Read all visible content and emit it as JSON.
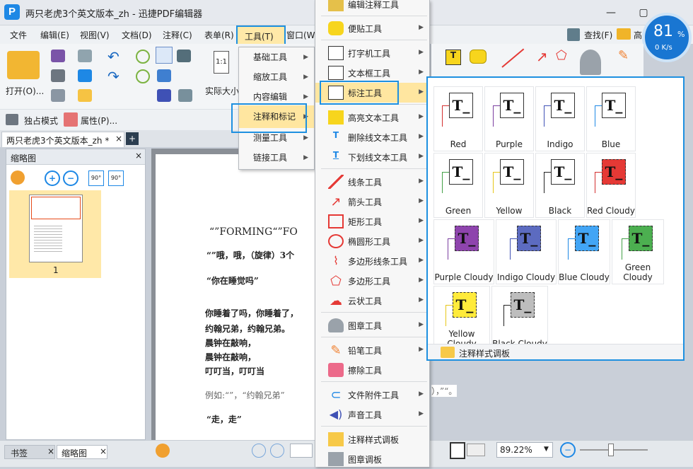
{
  "window": {
    "title": "两只老虎3个英文版本_zh - 迅捷PDF编辑器",
    "logo": "P"
  },
  "menubar": [
    "文件",
    "编辑(E)",
    "视图(V)",
    "文档(D)",
    "注释(C)",
    "表单(R)",
    "工具(T)",
    "窗口(W",
    "查找(F)",
    "高"
  ],
  "ribbon": {
    "open": "打开(O)...",
    "actual_size": "实际大小",
    "single_mode": "独占模式",
    "properties": "属性(P)..."
  },
  "doc_tab": "两只老虎3个英文版本_zh *",
  "thumb_panel": {
    "title": "缩略图",
    "page_num": "1"
  },
  "doc_text": {
    "heading": "“”FORMING“”FO",
    "line1": "“”哦，哦，（旋律）3个",
    "line2": "“你在睡觉吗”",
    "p1": "你睡着了吗，你睡着了，",
    "p2": "约翰兄弟，约翰兄弟。",
    "p3": "晨钟在敲响，",
    "p4": "晨钟在敲响，",
    "p5": "叮叮当，叮叮当",
    "ex": "例如:“”，“约翰兄弟”",
    "ex_tail": "），”“。",
    "walk": "“走，走”"
  },
  "menu_tools": [
    "基础工具",
    "缩放工具",
    "内容编辑",
    "注释和标记",
    "测量工具",
    "链接工具"
  ],
  "menu_annot": [
    "编辑注释工具",
    "便贴工具",
    "打字机工具",
    "文本框工具",
    "标注工具",
    "高亮文本工具",
    "删除线文本工具",
    "下划线文本工具",
    "线条工具",
    "箭头工具",
    "矩形工具",
    "椭圆形工具",
    "多边形线条工具",
    "多边形工具",
    "云状工具",
    "图章工具",
    "铅笔工具",
    "擦除工具",
    "文件附件工具",
    "声音工具",
    "注释样式调板",
    "图章调板"
  ],
  "palette": {
    "footer": "注释样式调板",
    "tiles": [
      {
        "label": "Red",
        "color": "#d32f2f",
        "fill": ""
      },
      {
        "label": "Purple",
        "color": "#7b3fa0",
        "fill": ""
      },
      {
        "label": "Indigo",
        "color": "#3f51b5",
        "fill": ""
      },
      {
        "label": "Blue",
        "color": "#1e88e5",
        "fill": ""
      },
      {
        "label": "Green",
        "color": "#43a047",
        "fill": ""
      },
      {
        "label": "Yellow",
        "color": "#e6c619",
        "fill": ""
      },
      {
        "label": "Black",
        "color": "#222222",
        "fill": ""
      },
      {
        "label": "Red Cloudy",
        "color": "#d32f2f",
        "fill": "#e53935"
      },
      {
        "label": "Purple Cloudy",
        "color": "#7b3fa0",
        "fill": "#8e44ad"
      },
      {
        "label": "Indigo Cloudy",
        "color": "#3f51b5",
        "fill": "#5c6bc0"
      },
      {
        "label": "Blue Cloudy",
        "color": "#1e88e5",
        "fill": "#42a5f5"
      },
      {
        "label": "Green Cloudy",
        "color": "#43a047",
        "fill": "#4caf50"
      },
      {
        "label": "Yellow Cloudy",
        "color": "#e6c619",
        "fill": "#ffeb3b"
      },
      {
        "label": "Black Cloudy",
        "color": "#222222",
        "fill": "#bdbdbd"
      }
    ]
  },
  "status": {
    "zoom": "89.22%",
    "bottom_tabs": [
      "书签",
      "缩略图"
    ]
  },
  "gauge": {
    "percent": "81",
    "unit": "%",
    "speed": "0 K/s"
  }
}
